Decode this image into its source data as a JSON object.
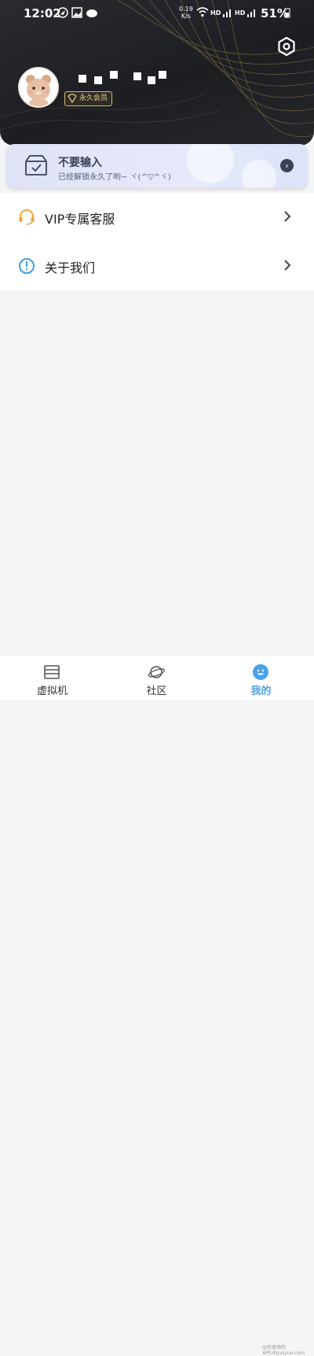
{
  "status_bar": {
    "time": "12:02",
    "network_speed_value": "0.19",
    "network_speed_unit": "K/s",
    "hd1": "HD",
    "hd2": "HD",
    "battery": "51%",
    "icons": [
      "navigation-icon",
      "gallery-icon",
      "cloud-icon",
      "wifi-icon",
      "signal-icon",
      "battery-icon"
    ]
  },
  "profile": {
    "membership_badge": "永久会员"
  },
  "vip_card": {
    "title": "不要输入",
    "subtitle": "已经解锁永久了哟~ ヾ(^▽^ヾ)"
  },
  "menu": [
    {
      "label": "VIP专属客服",
      "icon": "headset-icon"
    },
    {
      "label": "关于我们",
      "icon": "info-icon"
    }
  ],
  "tabs": [
    {
      "label": "虚拟机",
      "icon": "virtual-machine-icon",
      "active": false
    },
    {
      "label": "社区",
      "icon": "planet-icon",
      "active": false
    },
    {
      "label": "我的",
      "icon": "profile-icon",
      "active": true
    }
  ],
  "colors": {
    "header_bg": "#1f2025",
    "accent": "#4aa3e8",
    "vip_card_bg": "#e2e6f8",
    "badge_gold": "#d8b766"
  },
  "watermark": "@你使用的APP.dlgvsyuo.com"
}
